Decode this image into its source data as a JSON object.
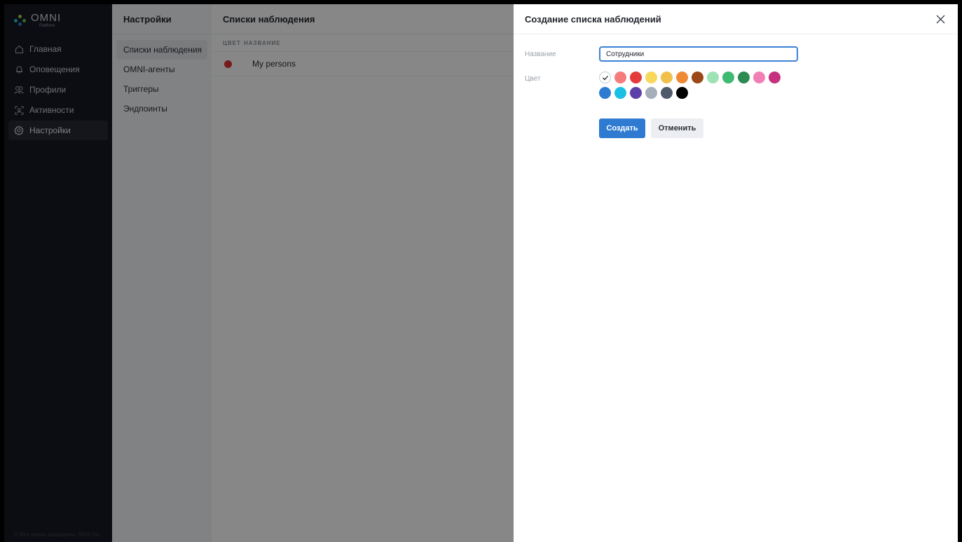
{
  "sidebar": {
    "logo": {
      "name": "OMNI",
      "sub": "Platform"
    },
    "items": [
      {
        "label": "Главная",
        "icon": "home-icon"
      },
      {
        "label": "Оповещения",
        "icon": "bell-icon"
      },
      {
        "label": "Профили",
        "icon": "profiles-icon"
      },
      {
        "label": "Активности",
        "icon": "activity-icon"
      },
      {
        "label": "Настройки",
        "icon": "gear-icon",
        "active": true
      }
    ],
    "footer": "© Все права защищены 3DiVi Inc."
  },
  "settings": {
    "title": "Настройки",
    "items": [
      {
        "label": "Списки наблюдения",
        "active": true
      },
      {
        "label": "OMNI-агенты"
      },
      {
        "label": "Триггеры"
      },
      {
        "label": "Эндпоинты"
      }
    ]
  },
  "main": {
    "title": "Списки наблюдения",
    "columns": {
      "color": "ЦВЕТ",
      "name": "НАЗВАНИЕ"
    },
    "rows": [
      {
        "color": "#e03434",
        "name": "My persons"
      }
    ]
  },
  "drawer": {
    "title": "Создание списка наблюдений",
    "name_label": "Название",
    "name_value": "Сотрудники",
    "color_label": "Цвет",
    "colors_row1": [
      "#ffffff",
      "#f47c7c",
      "#e53a3a",
      "#f7d85a",
      "#f0c04a",
      "#ee8a34",
      "#9a4719",
      "#9ee3b5",
      "#3fba73",
      "#2b8a52",
      "#f27fb4",
      "#c7307e"
    ],
    "colors_row2": [
      "#2f7bd2",
      "#19c0e4",
      "#5d3fa8",
      "#a6aeb9",
      "#505a6b",
      "#000000"
    ],
    "create_label": "Создать",
    "cancel_label": "Отменить"
  }
}
